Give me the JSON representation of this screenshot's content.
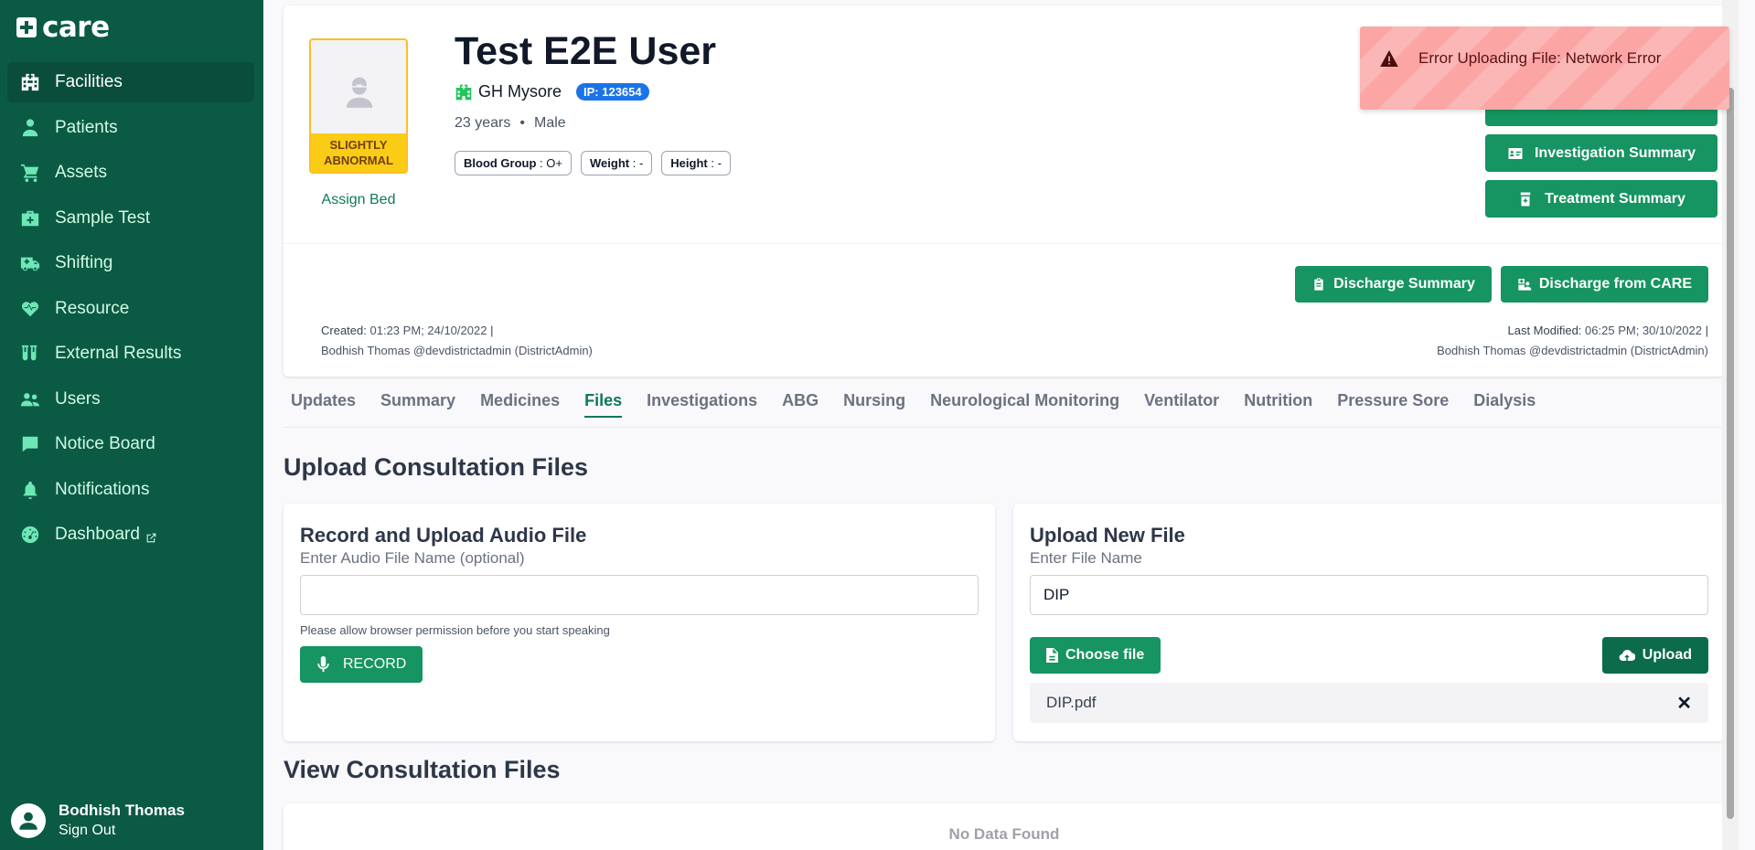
{
  "sidebar": {
    "logo_text": "care",
    "items": [
      {
        "label": "Facilities",
        "icon": "hospital-icon"
      },
      {
        "label": "Patients",
        "icon": "patient-icon"
      },
      {
        "label": "Assets",
        "icon": "cart-icon"
      },
      {
        "label": "Sample Test",
        "icon": "medkit-icon"
      },
      {
        "label": "Shifting",
        "icon": "ambulance-icon"
      },
      {
        "label": "Resource",
        "icon": "heartbeat-icon"
      },
      {
        "label": "External Results",
        "icon": "test-tubes-icon"
      },
      {
        "label": "Users",
        "icon": "users-icon"
      },
      {
        "label": "Notice Board",
        "icon": "message-icon"
      },
      {
        "label": "Notifications",
        "icon": "bell-icon"
      },
      {
        "label": "Dashboard",
        "icon": "gauge-icon"
      }
    ],
    "active": "Facilities",
    "user_name": "Bodhish Thomas",
    "sign_out": "Sign Out"
  },
  "patient": {
    "name": "Test E2E User",
    "facility": "GH Mysore",
    "ip_badge": "IP: 123654",
    "age": "23 years",
    "dot": "•",
    "gender": "Male",
    "severity_line1": "SLIGHTLY",
    "severity_line2": "ABNORMAL",
    "assign_bed": "Assign Bed",
    "chips": [
      {
        "label": "Blood Group",
        "sep": " : ",
        "value": "O+"
      },
      {
        "label": "Weight",
        "sep": " : ",
        "value": "-"
      },
      {
        "label": "Height",
        "sep": " : ",
        "value": "-"
      }
    ]
  },
  "actions": {
    "investigation_summary": "Investigation Summary",
    "treatment_summary": "Treatment Summary",
    "discharge_summary": "Discharge Summary",
    "discharge_from_care": "Discharge from CARE"
  },
  "meta": {
    "created_label": "Created:",
    "created_value": "01:23 PM; 24/10/2022",
    "created_by": "Bodhish Thomas @devdistrictadmin (DistrictAdmin)",
    "modified_label": "Last Modified:",
    "modified_value": "06:25 PM; 30/10/2022",
    "modified_by": "Bodhish Thomas @devdistrictadmin (DistrictAdmin)",
    "separator": "|"
  },
  "tabs": [
    "Updates",
    "Summary",
    "Medicines",
    "Files",
    "Investigations",
    "ABG",
    "Nursing",
    "Neurological Monitoring",
    "Ventilator",
    "Nutrition",
    "Pressure Sore",
    "Dialysis"
  ],
  "active_tab": "Files",
  "upload_section": {
    "title": "Upload Consultation Files",
    "audio_card": {
      "title": "Record and Upload Audio File",
      "subtitle": "Enter Audio File Name (optional)",
      "input_value": "",
      "hint": "Please allow browser permission before you start speaking",
      "record_label": "RECORD"
    },
    "file_card": {
      "title": "Upload New File",
      "subtitle": "Enter File Name",
      "input_value": "DIP",
      "choose_label": "Choose file",
      "upload_label": "Upload",
      "selected_file": "DIP.pdf",
      "close_symbol": "✕"
    }
  },
  "view_section": {
    "title": "View Consultation Files",
    "empty": "No Data Found"
  },
  "toast": {
    "message": "Error Uploading File: Network Error"
  },
  "colors": {
    "sidebar_bg": "#0b5a44",
    "primary": "#169461",
    "severity": "#facc15",
    "toast_bg": "#fca5a5",
    "ip_badge": "#1a73e8"
  }
}
